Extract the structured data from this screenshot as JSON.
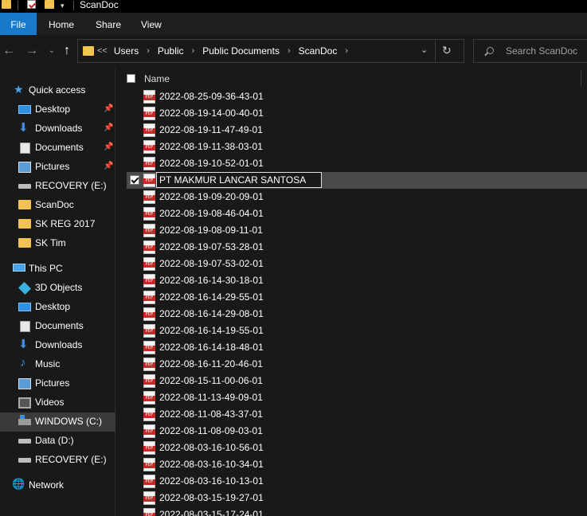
{
  "window": {
    "title": "ScanDoc"
  },
  "ribbon": {
    "tabs": [
      "File",
      "Home",
      "Share",
      "View"
    ]
  },
  "address": {
    "crumbs": [
      "Users",
      "Public",
      "Public Documents",
      "ScanDoc"
    ],
    "lead": "<<",
    "search_placeholder": "Search ScanDoc"
  },
  "nav": {
    "quick_access": "Quick access",
    "quick_items": [
      "Desktop",
      "Downloads",
      "Documents",
      "Pictures",
      "RECOVERY (E:)",
      "ScanDoc",
      "SK REG 2017",
      "SK Tim"
    ],
    "this_pc": "This PC",
    "pc_items": [
      "3D Objects",
      "Desktop",
      "Documents",
      "Downloads",
      "Music",
      "Pictures",
      "Videos",
      "WINDOWS (C:)",
      "Data (D:)",
      "RECOVERY (E:)"
    ],
    "network": "Network"
  },
  "list": {
    "header_name": "Name",
    "files": [
      "2022-08-25-09-36-43-01",
      "2022-08-19-14-00-40-01",
      "2022-08-19-11-47-49-01",
      "2022-08-19-11-38-03-01",
      "2022-08-19-10-52-01-01",
      "PT MAKMUR LANCAR SANTOSA",
      "2022-08-19-09-20-09-01",
      "2022-08-19-08-46-04-01",
      "2022-08-19-08-09-11-01",
      "2022-08-19-07-53-28-01",
      "2022-08-19-07-53-02-01",
      "2022-08-16-14-30-18-01",
      "2022-08-16-14-29-55-01",
      "2022-08-16-14-29-08-01",
      "2022-08-16-14-19-55-01",
      "2022-08-16-14-18-48-01",
      "2022-08-16-11-20-46-01",
      "2022-08-15-11-00-06-01",
      "2022-08-11-13-49-09-01",
      "2022-08-11-08-43-37-01",
      "2022-08-11-08-09-03-01",
      "2022-08-03-16-10-56-01",
      "2022-08-03-16-10-34-01",
      "2022-08-03-16-10-13-01",
      "2022-08-03-15-19-27-01",
      "2022-08-03-15-17-24-01"
    ]
  }
}
